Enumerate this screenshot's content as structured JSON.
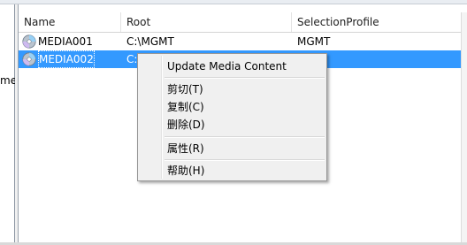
{
  "left_pane": {
    "partial_label": "me"
  },
  "list": {
    "columns": [
      "Name",
      "Root",
      "SelectionProfile"
    ],
    "rows": [
      {
        "name": "MEDIA001",
        "root": "C:\\MGMT",
        "profile": "MGMT",
        "selected": false
      },
      {
        "name": "MEDIA002",
        "root": "C:\\",
        "profile": "",
        "selected": true
      }
    ]
  },
  "context_menu": {
    "items": [
      {
        "label": "Update Media Content"
      },
      {
        "label": "剪切(T)"
      },
      {
        "label": "复制(C)"
      },
      {
        "label": "删除(D)"
      },
      {
        "label": "属性(R)"
      },
      {
        "label": "帮助(H)"
      }
    ]
  },
  "colors": {
    "selection": "#3399ff",
    "menu_background": "#f0f0f0",
    "menu_border": "#979797"
  },
  "icons": {
    "row_icon": "disc-icon"
  }
}
